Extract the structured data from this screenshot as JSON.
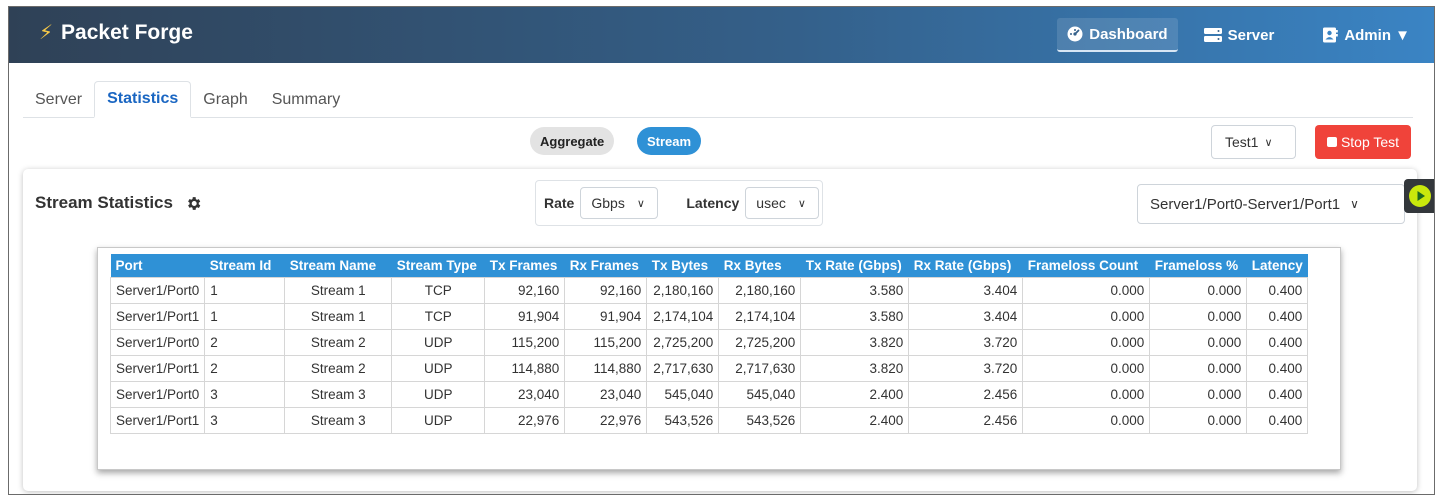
{
  "app": {
    "title": "Packet Forge"
  },
  "nav": {
    "dashboard": "Dashboard",
    "server": "Server",
    "admin": "Admin ▼"
  },
  "tabs": [
    "Server",
    "Statistics",
    "Graph",
    "Summary"
  ],
  "view_toggle": {
    "aggregate": "Aggregate",
    "stream": "Stream",
    "selected": "Stream"
  },
  "test_select": {
    "value": "Test1"
  },
  "stop_button": "Stop Test",
  "card": {
    "title": "Stream Statistics",
    "rate_label": "Rate",
    "rate_value": "Gbps",
    "latency_label": "Latency",
    "latency_value": "usec",
    "port_pair": "Server1/Port0-Server1/Port1"
  },
  "table": {
    "headers": [
      "Port",
      "Stream Id",
      "Stream Name",
      "Stream Type",
      "Tx Frames",
      "Rx Frames",
      "Tx Bytes",
      "Rx Bytes",
      "Tx Rate (Gbps)",
      "Rx Rate (Gbps)",
      "Frameloss Count",
      "Frameloss %",
      "Latency"
    ],
    "rows": [
      [
        "Server1/Port0",
        "1",
        "Stream 1",
        "TCP",
        "92,160",
        "92,160",
        "2,180,160",
        "2,180,160",
        "3.580",
        "3.404",
        "0.000",
        "0.000",
        "0.400"
      ],
      [
        "Server1/Port1",
        "1",
        "Stream 1",
        "TCP",
        "91,904",
        "91,904",
        "2,174,104",
        "2,174,104",
        "3.580",
        "3.404",
        "0.000",
        "0.000",
        "0.400"
      ],
      [
        "Server1/Port0",
        "2",
        "Stream 2",
        "UDP",
        "115,200",
        "115,200",
        "2,725,200",
        "2,725,200",
        "3.820",
        "3.720",
        "0.000",
        "0.000",
        "0.400"
      ],
      [
        "Server1/Port1",
        "2",
        "Stream 2",
        "UDP",
        "114,880",
        "114,880",
        "2,717,630",
        "2,717,630",
        "3.820",
        "3.720",
        "0.000",
        "0.000",
        "0.400"
      ],
      [
        "Server1/Port0",
        "3",
        "Stream 3",
        "UDP",
        "23,040",
        "23,040",
        "545,040",
        "545,040",
        "2.400",
        "2.456",
        "0.000",
        "0.000",
        "0.400"
      ],
      [
        "Server1/Port1",
        "3",
        "Stream 3",
        "UDP",
        "22,976",
        "22,976",
        "543,526",
        "543,526",
        "2.400",
        "2.456",
        "0.000",
        "0.000",
        "0.400"
      ]
    ]
  },
  "colors": {
    "accent": "#2f91d6",
    "danger": "#f0433a",
    "tab_active": "#1a66c2",
    "play": "#c9e80c"
  },
  "icons": [
    "bolt-icon",
    "dashboard-icon",
    "server-icon",
    "admin-icon",
    "gear-icon",
    "play-icon",
    "chevron-down-icon",
    "stop-icon"
  ]
}
